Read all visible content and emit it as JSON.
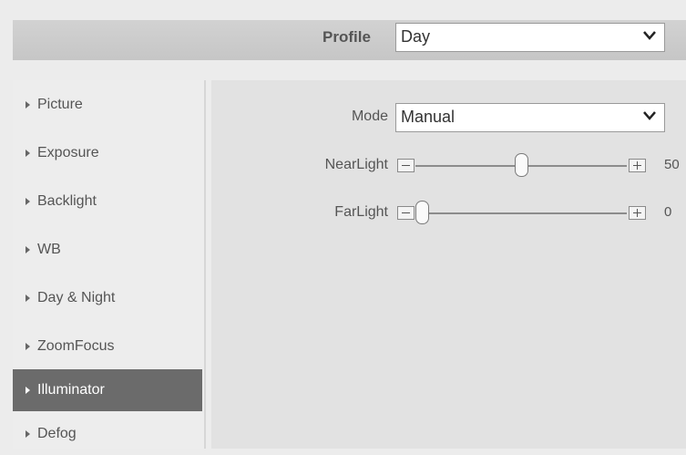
{
  "header": {
    "profile_label": "Profile",
    "profile_value": "Day"
  },
  "sidebar": {
    "items": [
      {
        "label": "Picture",
        "active": false
      },
      {
        "label": "Exposure",
        "active": false
      },
      {
        "label": "Backlight",
        "active": false
      },
      {
        "label": "WB",
        "active": false
      },
      {
        "label": "Day & Night",
        "active": false
      },
      {
        "label": "ZoomFocus",
        "active": false
      },
      {
        "label": "Illuminator",
        "active": true
      },
      {
        "label": "Defog",
        "active": false
      }
    ]
  },
  "illuminator": {
    "mode_label": "Mode",
    "mode_value": "Manual",
    "near_light": {
      "label": "NearLight",
      "value": "50",
      "level": 0.5
    },
    "far_light": {
      "label": "FarLight",
      "value": "0",
      "level": 0.0
    }
  },
  "colors": {
    "active_item_bg": "#6b6b6b",
    "header_bg": "#cbcbcb"
  },
  "icons": {
    "dropdown": "chevron-down-icon",
    "decrement": "minus-icon",
    "increment": "plus-icon",
    "item": "triangle-right-icon"
  }
}
